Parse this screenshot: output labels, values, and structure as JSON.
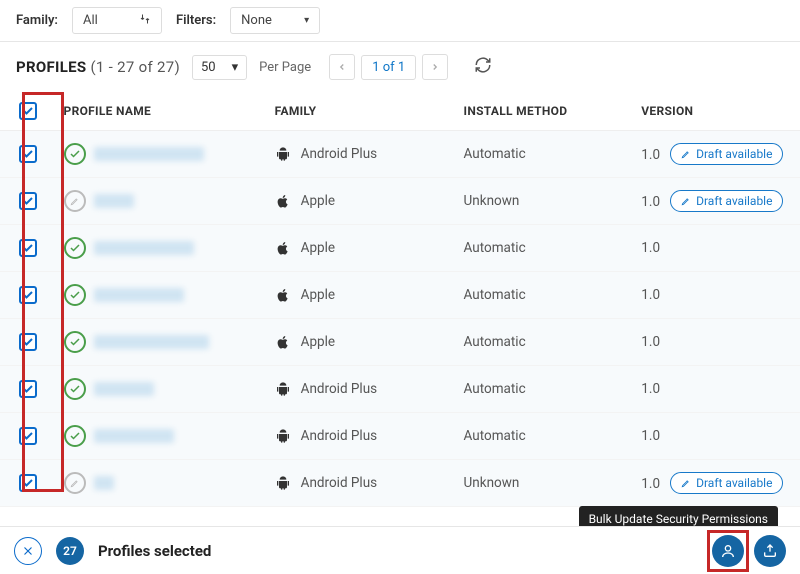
{
  "topbar": {
    "family_label": "Family:",
    "family_value": "All",
    "filters_label": "Filters:",
    "filters_value": "None"
  },
  "profiles_heading": {
    "label": "PROFILES",
    "range": "(1 - 27 of 27)"
  },
  "pagination": {
    "page_size": "50",
    "per_page_label": "Per Page",
    "page_status": "1 of 1"
  },
  "columns": {
    "name": "PROFILE NAME",
    "family": "FAMILY",
    "install": "INSTALL METHOD",
    "version": "VERSION"
  },
  "rows": [
    {
      "status": "ok",
      "name_w": 110,
      "family": "Android Plus",
      "os": "android",
      "install": "Automatic",
      "version": "1.0",
      "draft": true
    },
    {
      "status": "draft",
      "name_w": 40,
      "family": "Apple",
      "os": "apple",
      "install": "Unknown",
      "version": "1.0",
      "draft": true
    },
    {
      "status": "ok",
      "name_w": 100,
      "family": "Apple",
      "os": "apple",
      "install": "Automatic",
      "version": "1.0",
      "draft": false
    },
    {
      "status": "ok",
      "name_w": 90,
      "family": "Apple",
      "os": "apple",
      "install": "Automatic",
      "version": "1.0",
      "draft": false
    },
    {
      "status": "ok",
      "name_w": 115,
      "family": "Apple",
      "os": "apple",
      "install": "Automatic",
      "version": "1.0",
      "draft": false
    },
    {
      "status": "ok",
      "name_w": 60,
      "family": "Android Plus",
      "os": "android",
      "install": "Automatic",
      "version": "1.0",
      "draft": false
    },
    {
      "status": "ok",
      "name_w": 80,
      "family": "Android Plus",
      "os": "android",
      "install": "Automatic",
      "version": "1.0",
      "draft": false
    },
    {
      "status": "draft",
      "name_w": 20,
      "family": "Android Plus",
      "os": "android",
      "install": "Unknown",
      "version": "1.0",
      "draft": true
    }
  ],
  "draft_label": "Draft available",
  "footer": {
    "count": "27",
    "selected_label": "Profiles selected",
    "tooltip": "Bulk Update Security Permissions"
  }
}
